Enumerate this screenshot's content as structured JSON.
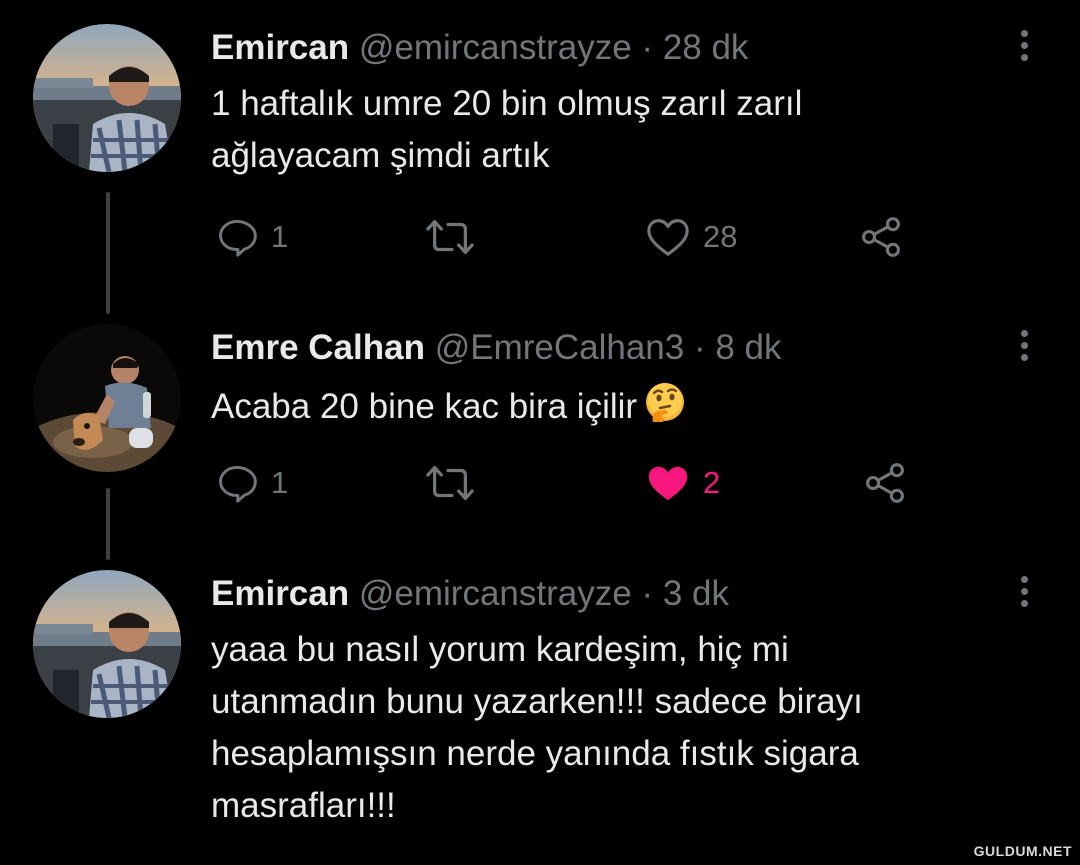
{
  "tweets": [
    {
      "name": "Emircan",
      "handle": "@emircanstrayze",
      "separator": "·",
      "time": "28 dk",
      "text_lines": [
        "1 haftalık umre 20 bin olmuş zarıl zarıl",
        "ağlayacam şimdi artık"
      ],
      "reply_count": "1",
      "retweet_count": "",
      "like_count": "28",
      "liked": false,
      "avatar": "man-in-plaid-shirt-at-sunset-avatar"
    },
    {
      "name": "Emre Calhan",
      "handle": "@EmreCalhan3",
      "separator": "·",
      "time": "8 dk",
      "text_lines": [
        "Acaba 20 bine kac bira içilir"
      ],
      "emoji": "thinking-face",
      "reply_count": "1",
      "retweet_count": "",
      "like_count": "2",
      "liked": true,
      "avatar": "man-with-dog-at-night-avatar"
    },
    {
      "name": "Emircan",
      "handle": "@emircanstrayze",
      "separator": "·",
      "time": "3 dk",
      "text_lines": [
        "yaaa bu nasıl yorum kardeşim, hiç mi",
        "utanmadın bunu yazarken!!! sadece birayı",
        "hesaplamışsın nerde yanında fıstık sigara",
        "masrafları!!!"
      ],
      "avatar": "man-in-plaid-shirt-at-sunset-avatar"
    }
  ],
  "watermark": "GULDUM.NET",
  "colors": {
    "background": "#000000",
    "primary_text": "#e7e9ea",
    "secondary_text": "#71767b",
    "like_active": "#f91880",
    "thread_line": "#3e4144"
  },
  "icons": [
    "reply-icon",
    "retweet-icon",
    "like-icon",
    "share-icon",
    "more-icon",
    "thinking-face-emoji"
  ]
}
